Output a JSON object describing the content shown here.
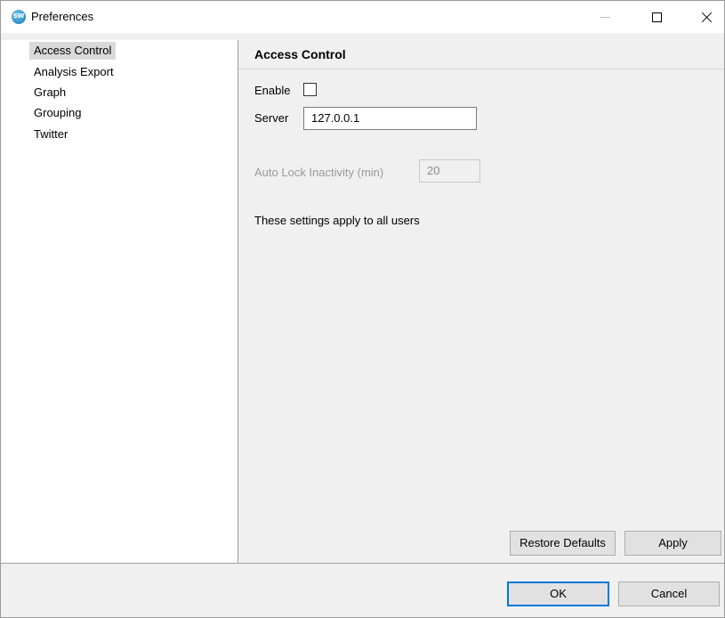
{
  "window": {
    "title": "Preferences",
    "icon": "app-logo-icon",
    "icon_text": "SW",
    "controls": [
      "minimize-icon",
      "maximize-icon",
      "close-icon"
    ]
  },
  "sidebar": {
    "items": [
      {
        "label": "Access Control",
        "selected": true
      },
      {
        "label": "Analysis Export",
        "selected": false
      },
      {
        "label": "Graph",
        "selected": false
      },
      {
        "label": "Grouping",
        "selected": false
      },
      {
        "label": "Twitter",
        "selected": false
      }
    ]
  },
  "page": {
    "title": "Access Control",
    "enable": {
      "label": "Enable",
      "checked": false
    },
    "server": {
      "label": "Server",
      "value": "127.0.0.1"
    },
    "auto_lock": {
      "label": "Auto Lock Inactivity (min)",
      "value": "20",
      "disabled": true
    },
    "note": "These settings apply to all users",
    "restore_defaults_label": "Restore Defaults",
    "apply_label": "Apply"
  },
  "footer": {
    "ok_label": "OK",
    "cancel_label": "Cancel"
  },
  "colors": {
    "selection": "#d9d9d9",
    "default_button_border": "#0078d7",
    "panel_bg": "#f0f0f0"
  }
}
